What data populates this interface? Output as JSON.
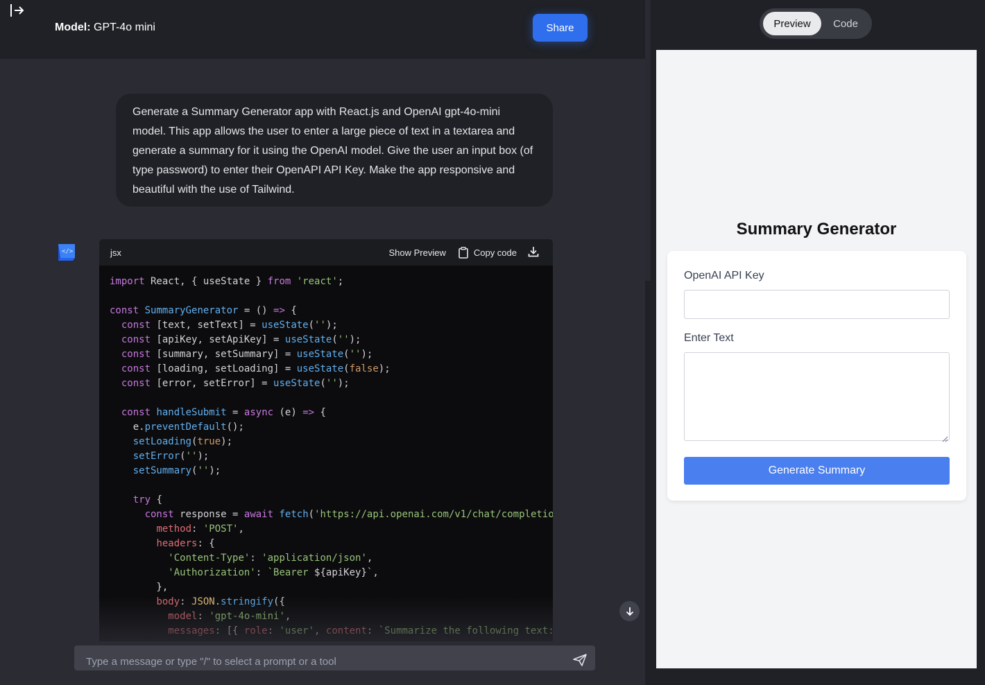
{
  "header": {
    "model_prefix": "Model:",
    "model_name": "GPT-4o mini",
    "share_label": "Share"
  },
  "user_message": "Generate a Summary Generator app with React.js and OpenAI gpt-4o-mini model. This app allows the user to enter a large piece of text in a textarea and generate a summary for it using the OpenAI model. Give the user an input box (of type password) to enter their OpenAPI API Key. Make the app responsive and beautiful with the use of Tailwind.",
  "code_block": {
    "language": "jsx",
    "show_preview_label": "Show Preview",
    "copy_label": "Copy code"
  },
  "chat_input": {
    "placeholder": "Type a message or type \"/\" to select a prompt or a tool"
  },
  "preview_toggle": {
    "preview_label": "Preview",
    "code_label": "Code"
  },
  "preview_app": {
    "title": "Summary Generator",
    "api_key_label": "OpenAI API Key",
    "text_label": "Enter Text",
    "button_label": "Generate Summary"
  },
  "icons": {
    "sidebar_toggle": "sidebar-expand-icon",
    "avatar": "code-bot-icon",
    "copy": "clipboard-icon",
    "download": "download-icon",
    "scroll": "arrow-down-icon",
    "send": "send-icon"
  },
  "colors": {
    "accent": "#2f6fed",
    "preview_button": "#4a7ff0"
  }
}
